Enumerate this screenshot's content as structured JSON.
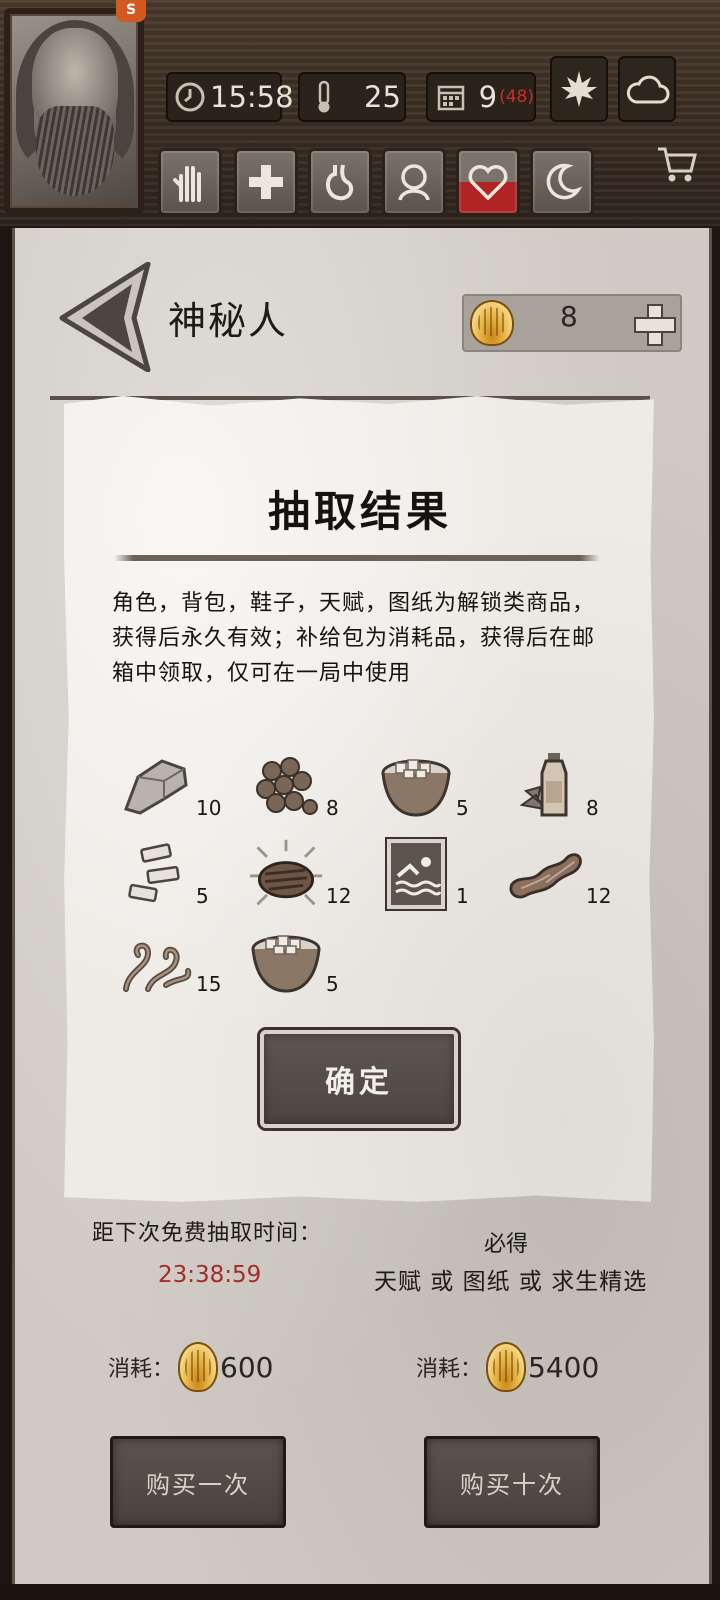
{
  "hud": {
    "time": "15:58",
    "temperature": "25",
    "day": "9",
    "day_extra": "(48)",
    "badge": "S",
    "weather_buttons": [
      "leaf-icon",
      "cloud-icon"
    ],
    "status_buttons": [
      "hand-icon",
      "health-cross-icon",
      "stomach-icon",
      "head-icon",
      "heart-icon",
      "moon-icon"
    ]
  },
  "header": {
    "title": "神秘人",
    "currency_value": "8"
  },
  "dialog": {
    "title": "抽取结果",
    "description": "角色，背包，鞋子，天赋，图纸为解锁类商品，获得后永久有效；补给包为消耗品，获得后在邮箱中领取，仅可在一局中使用",
    "confirm_label": "确定",
    "rewards": [
      {
        "icon": "stone-icon",
        "count": "10"
      },
      {
        "icon": "nuts-icon",
        "count": "8"
      },
      {
        "icon": "basket-icon",
        "count": "5"
      },
      {
        "icon": "bottle-herb-icon",
        "count": "8"
      },
      {
        "icon": "bandage-icon",
        "count": "5"
      },
      {
        "icon": "grilled-meat-icon",
        "count": "12"
      },
      {
        "icon": "swimming-card-icon",
        "count": "1"
      },
      {
        "icon": "jerky-icon",
        "count": "12"
      },
      {
        "icon": "rope-icon",
        "count": "15"
      },
      {
        "icon": "basket-icon",
        "count": "5"
      }
    ]
  },
  "bottom": {
    "free_label": "距下次免费抽取时间：",
    "free_timer": "23:38:59",
    "guarantee_title": "必得",
    "guarantee_desc": "天赋 或 图纸 或 求生精选",
    "cost_label": "消耗：",
    "cost_one": "600",
    "cost_ten": "5400",
    "buy_one": "购买一次",
    "buy_ten": "购买十次"
  },
  "colors": {
    "accent_red": "#a52a2a",
    "shell_gold": "#e9b84a",
    "wood": "#3b2e23"
  }
}
